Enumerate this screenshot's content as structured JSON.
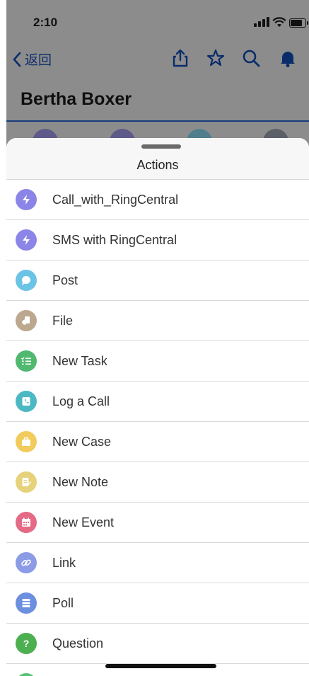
{
  "status_bar": {
    "time": "2:10"
  },
  "nav": {
    "back_label": "返回"
  },
  "record": {
    "title": "Bertha Boxer"
  },
  "sheet": {
    "title": "Actions"
  },
  "actions": [
    {
      "label": "Call_with_RingCentral",
      "icon": "lightning-icon",
      "color": "#8b85e8"
    },
    {
      "label": "SMS with RingCentral",
      "icon": "lightning-icon",
      "color": "#8b85e8"
    },
    {
      "label": "Post",
      "icon": "speech-bubble-icon",
      "color": "#6bc3e6"
    },
    {
      "label": "File",
      "icon": "file-hand-icon",
      "color": "#bba88f"
    },
    {
      "label": "New Task",
      "icon": "task-list-icon",
      "color": "#51b870"
    },
    {
      "label": "Log a Call",
      "icon": "phone-log-icon",
      "color": "#4cb8c4"
    },
    {
      "label": "New Case",
      "icon": "briefcase-icon",
      "color": "#f1cb5b"
    },
    {
      "label": "New Note",
      "icon": "note-icon",
      "color": "#e6d27a"
    },
    {
      "label": "New Event",
      "icon": "calendar-icon",
      "color": "#e56a86"
    },
    {
      "label": "Link",
      "icon": "link-icon",
      "color": "#8c9be6"
    },
    {
      "label": "Poll",
      "icon": "poll-icon",
      "color": "#6c8fe0"
    },
    {
      "label": "Question",
      "icon": "question-icon",
      "color": "#4caf50"
    }
  ]
}
